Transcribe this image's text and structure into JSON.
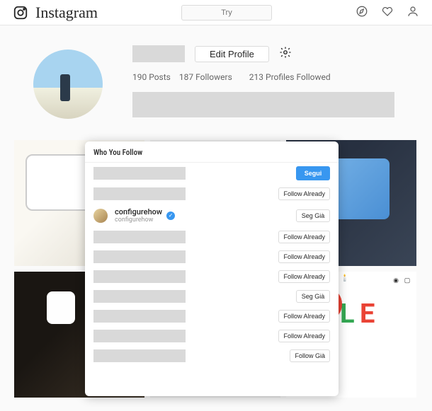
{
  "header": {
    "wordmark": "Instagram",
    "search_placeholder": "Try"
  },
  "profile": {
    "edit_label": "Edit Profile",
    "stats": {
      "posts_count": "190",
      "posts_label": "Posts",
      "followers_count": "187",
      "followers_label": "Followers",
      "following_count": "213",
      "following_label": "Profiles Followed"
    }
  },
  "modal": {
    "title": "Who You Follow",
    "rows": [
      {
        "type": "placeholder",
        "button": "Segui",
        "button_style": "blue"
      },
      {
        "type": "placeholder",
        "button": "Follow Already",
        "button_style": "plain"
      },
      {
        "type": "real",
        "username": "configurehow",
        "handle": "configurehow",
        "verified": true,
        "button": "Seg Già",
        "button_style": "plain"
      },
      {
        "type": "placeholder",
        "button": "Follow Already",
        "button_style": "plain"
      },
      {
        "type": "placeholder",
        "button": "Follow Already",
        "button_style": "plain"
      },
      {
        "type": "placeholder",
        "button": "Follow Already",
        "button_style": "plain"
      },
      {
        "type": "placeholder",
        "button": "Seg Già",
        "button_style": "plain"
      },
      {
        "type": "placeholder",
        "button": "Follow Already",
        "button_style": "plain"
      },
      {
        "type": "placeholder",
        "button": "Follow Already",
        "button_style": "plain"
      },
      {
        "type": "placeholder",
        "button": "Follow Già",
        "button_style": "plain"
      }
    ]
  }
}
